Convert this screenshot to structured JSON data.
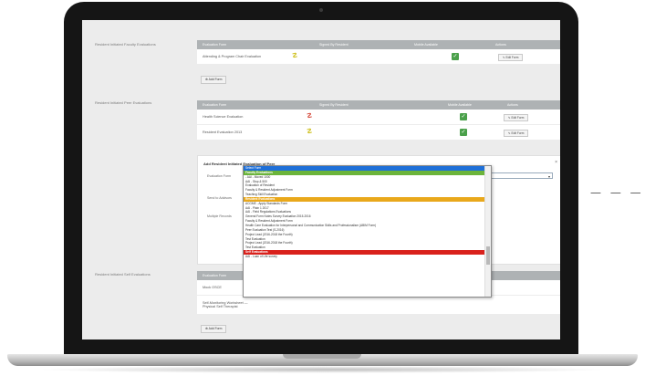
{
  "sections": {
    "faculty": {
      "label": "Resident Initiated Faculty Evaluations",
      "headers": [
        "Evaluation Form",
        "Signed By Resident",
        "Mobile Available",
        "Actions"
      ],
      "rows": [
        {
          "name": "Attending & Program Chair Evaluation",
          "signed_icon": "☡",
          "check": "✓",
          "action": "✎ Edit Form"
        }
      ],
      "add_button": "⊕ Add Form"
    },
    "peer": {
      "label": "Resident Initiated Peer Evaluations",
      "headers": [
        "Evaluation Form",
        "Signed By Resident",
        "Mobile Available",
        "Actions"
      ],
      "rows": [
        {
          "name": "Health Science Evaluation",
          "signed_icon": "☡",
          "check": "✓",
          "action": "✎ Edit Form"
        },
        {
          "name": "Resident Evaluation 2013",
          "signed_icon": "☡",
          "check": "✓",
          "action": "✎ Edit Form"
        }
      ]
    },
    "add_form": {
      "title": "Add Resident Initiated Evaluation of Peer",
      "close": "×",
      "fields": [
        "Evaluation Form",
        "Send to Advisors",
        "Multiple Records"
      ],
      "select_value": "Select Form",
      "select_caret": "▾"
    },
    "self": {
      "label": "Resident Initiated Self Evaluations",
      "headers": [
        "Evaluation Form"
      ],
      "rows": [
        {
          "name": "Mock OSCE"
        },
        {
          "name": "Self-Monitoring Worksheet — Physical Self Therapist"
        }
      ],
      "add_button": "⊕ Add Form"
    }
  },
  "dropdown_options": [
    {
      "label": "Select Form",
      "style": "selected"
    },
    {
      "label": "Faculty Evaluations",
      "style": "grp-green"
    },
    {
      "label": "- AAI - Moved 1000",
      "style": ""
    },
    {
      "label": "AAI - Stop & 500",
      "style": ""
    },
    {
      "label": "Evaluation of Resident",
      "style": ""
    },
    {
      "label": "Faculty & Resident Adjustment Form",
      "style": ""
    },
    {
      "label": "Teaching Skill Evaluation",
      "style": ""
    },
    {
      "label": "Resident Evaluations",
      "style": "grp-orange"
    },
    {
      "label": "ACGME - Apply Standards Form",
      "style": ""
    },
    {
      "label": "AAI - Plain 1 2017",
      "style": ""
    },
    {
      "label": "AAI - Field Regulations Evaluations",
      "style": ""
    },
    {
      "label": "General Form Notes Survey Evaluation 2015-2016",
      "style": ""
    },
    {
      "label": "Faculty & Resident Adjustment Form",
      "style": ""
    },
    {
      "label": "Health Care Evaluation for Interpersonal and Communication Skills and Professionalism (ABIM Form)",
      "style": ""
    },
    {
      "label": "Peer Evaluation Test (S-2016)",
      "style": ""
    },
    {
      "label": "Project Lead (2016-2018 the Fourth)",
      "style": ""
    },
    {
      "label": "Test Evaluation",
      "style": ""
    },
    {
      "label": "Project Lead (2016-2018 the Fourth)",
      "style": ""
    },
    {
      "label": "Test Evaluation",
      "style": ""
    },
    {
      "label": "Self Evaluations",
      "style": "grp-red"
    },
    {
      "label": "AAI - Loan of Life survey",
      "style": ""
    }
  ],
  "decorations": {
    "dashes": "— — —"
  }
}
